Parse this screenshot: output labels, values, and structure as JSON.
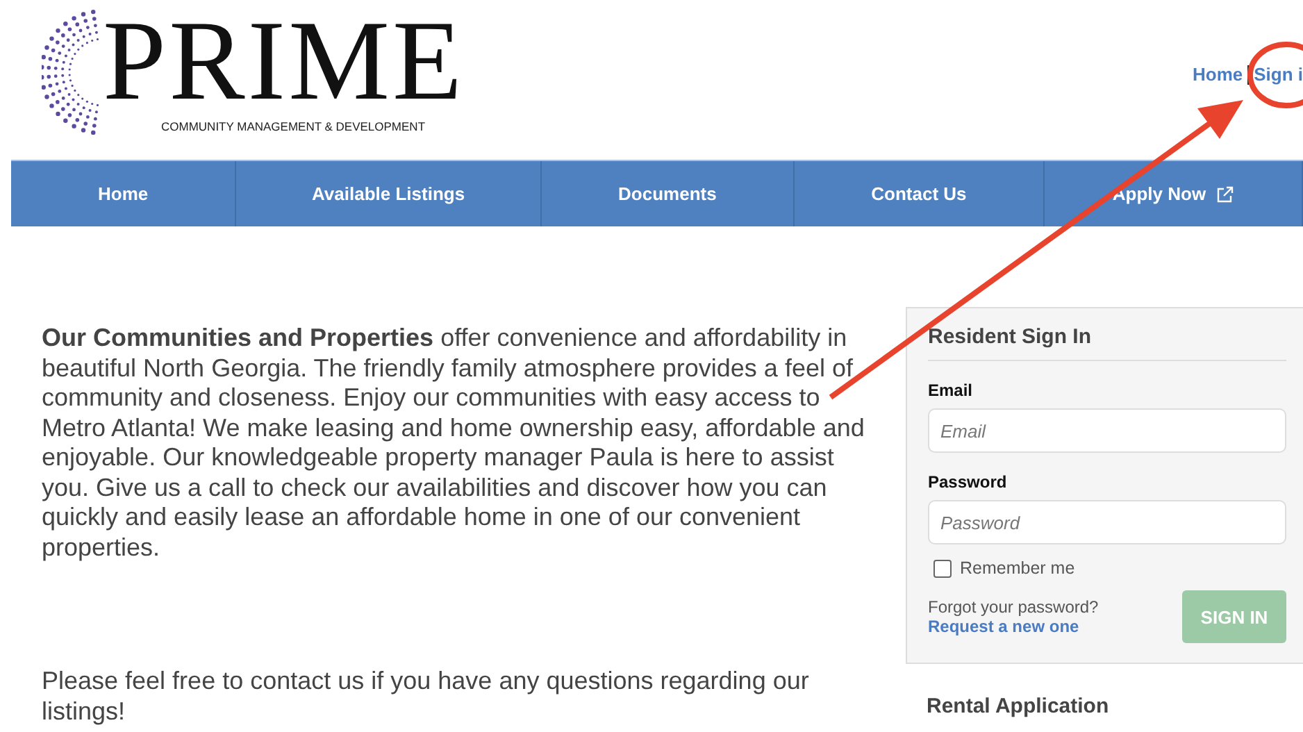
{
  "logo": {
    "title": "PRIME",
    "subtitle": "COMMUNITY MANAGEMENT & DEVELOPMENT"
  },
  "top_links": [
    "Home",
    "Sign i"
  ],
  "nav": [
    {
      "label": "Home",
      "external": false
    },
    {
      "label": "Available Listings",
      "external": false
    },
    {
      "label": "Documents",
      "external": false
    },
    {
      "label": "Contact Us",
      "external": false
    },
    {
      "label": "Apply Now",
      "external": true
    }
  ],
  "intro": "**Our Communities and Properties** offer convenience and affordability in beautiful North Georgia. The friendly family atmosphere provides a feel of community and closeness. Enjoy our communities with easy access to Metro Atlanta! We make leasing and home ownership easy, affordable and enjoyable. Our knowledgeable property manager Paula is here to assist you. Give us a call to check our availabilities and discover how you can quickly and easily lease an affordable home in one of our convenient properties.",
  "contact_note": "Please feel free to contact us if you have any questions regarding our listings!",
  "sign_in": {
    "title": "Resident Sign In",
    "fields": [
      {
        "label": "Email",
        "placeholder": "Email"
      },
      {
        "label": "Password",
        "placeholder": "Password"
      }
    ],
    "remember": {
      "label": "Remember me",
      "checked": false
    },
    "forgot": "Forgot your password?",
    "request_link": "Request a new one",
    "button": "SIGN IN",
    "button_disabled": true
  },
  "rental_title": "Rental Application"
}
